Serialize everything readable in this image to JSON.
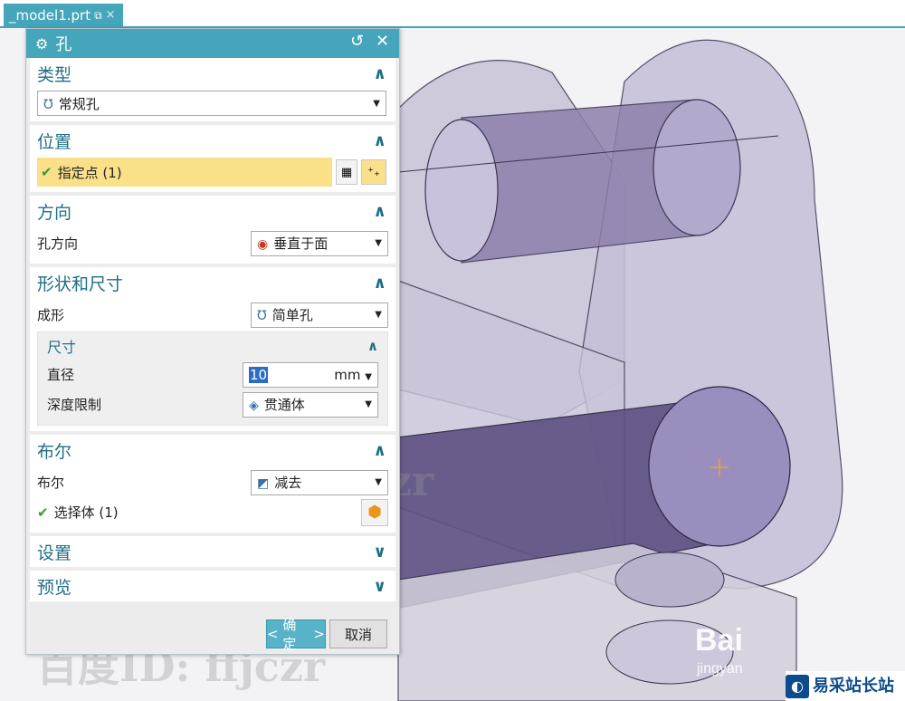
{
  "tab": {
    "title": "_model1.prt",
    "pin_icon": "pin-icon",
    "close": "×"
  },
  "dialog": {
    "title": "孔",
    "reset_icon": "↺",
    "close_icon": "✕",
    "sections": {
      "type": {
        "label": "类型",
        "select_value": "常规孔"
      },
      "position": {
        "label": "位置",
        "specify_point": "指定点 (1)"
      },
      "direction": {
        "label": "方向",
        "hole_dir_label": "孔方向",
        "hole_dir_value": "垂直于面"
      },
      "shape": {
        "label": "形状和尺寸",
        "form_label": "成形",
        "form_value": "简单孔",
        "dimensions": {
          "label": "尺寸",
          "diameter_label": "直径",
          "diameter_value": "10",
          "diameter_unit": "mm",
          "depth_limit_label": "深度限制",
          "depth_limit_value": "贯通体"
        }
      },
      "boolean": {
        "label": "布尔",
        "bool_label": "布尔",
        "bool_value": "减去",
        "select_body": "选择体 (1)"
      },
      "settings": {
        "label": "设置"
      },
      "preview": {
        "label": "预览"
      }
    },
    "ok_label": "确定",
    "cancel_label": "取消"
  },
  "watermarks": {
    "baidu_id": "百度ID: ffjczr"
  },
  "brand": {
    "name": "易采站长站",
    "sub": "jingyan",
    "baidu": "Bai"
  },
  "colors": {
    "accent": "#45a5bb",
    "highlight": "#fbe08a",
    "section_title": "#1f6f86"
  }
}
